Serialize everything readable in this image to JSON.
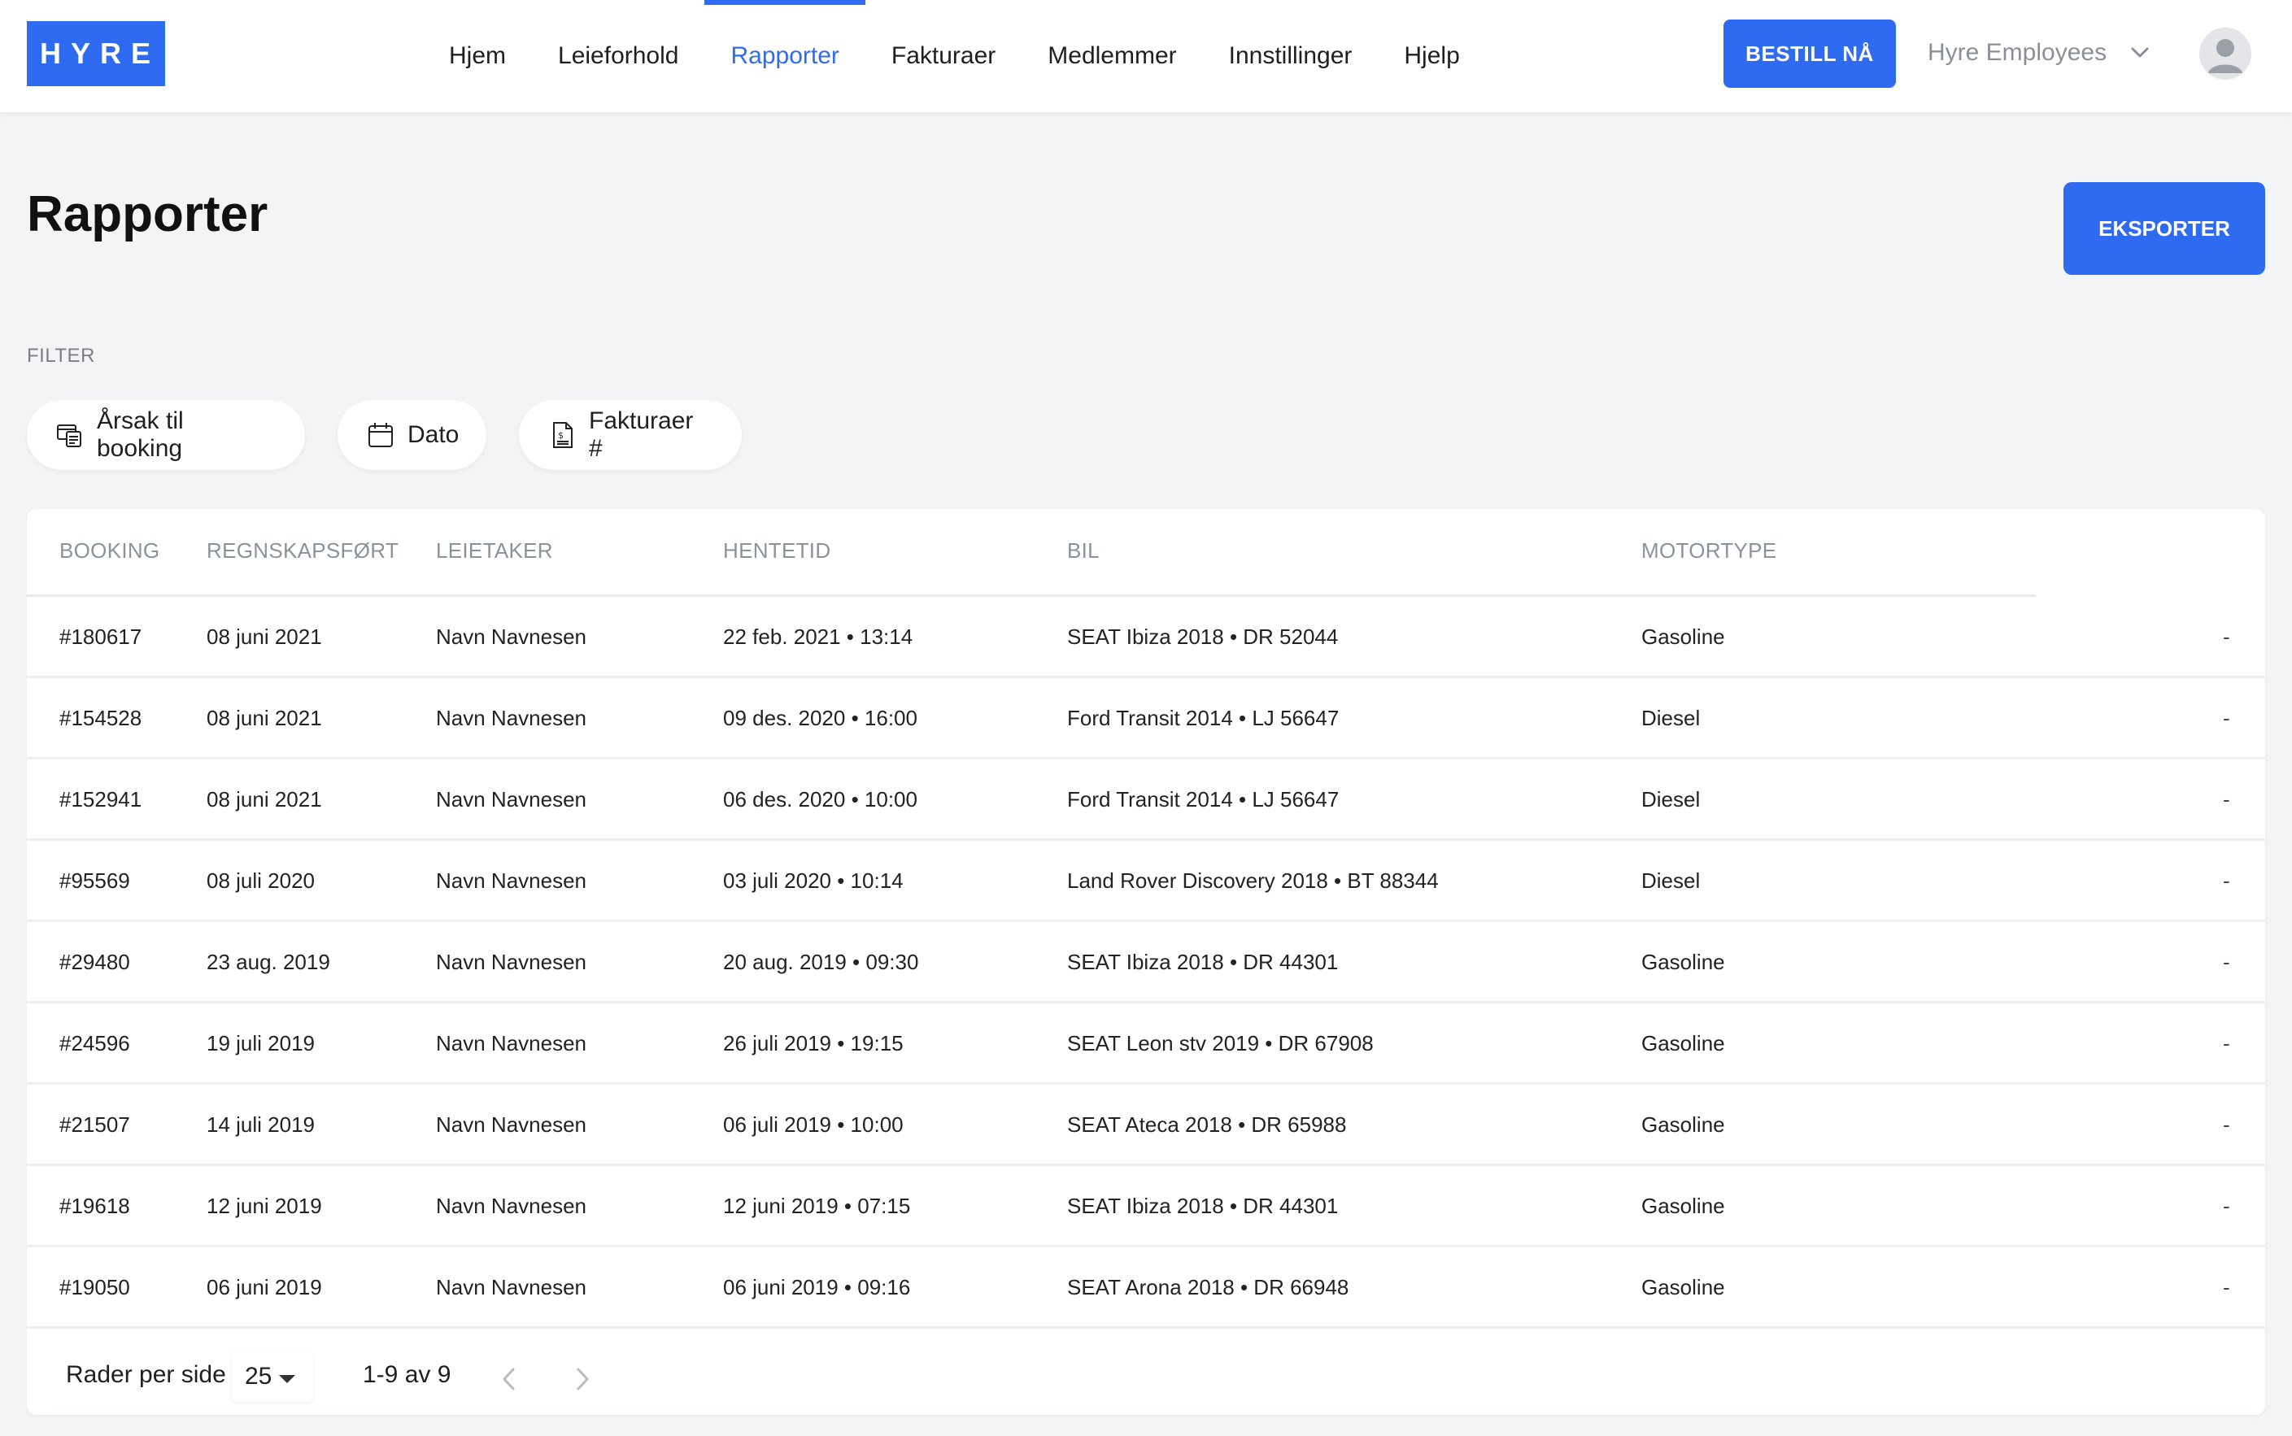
{
  "header": {
    "logo": "HYRE",
    "nav": [
      {
        "label": "Hjem",
        "active": false
      },
      {
        "label": "Leieforhold",
        "active": false
      },
      {
        "label": "Rapporter",
        "active": true
      },
      {
        "label": "Fakturaer",
        "active": false
      },
      {
        "label": "Medlemmer",
        "active": false
      },
      {
        "label": "Innstillinger",
        "active": false
      },
      {
        "label": "Hjelp",
        "active": false
      }
    ],
    "order_button": "BESTILL NÅ",
    "organization": "Hyre Employees",
    "organization_icon": "chevron-down-icon",
    "avatar_icon": "user-avatar-icon"
  },
  "page": {
    "title": "Rapporter",
    "export_button": "EKSPORTER"
  },
  "filters": {
    "label": "FILTER",
    "chips": [
      {
        "label": "Årsak til booking",
        "icon": "booking-reason-icon"
      },
      {
        "label": "Dato",
        "icon": "calendar-icon"
      },
      {
        "label": "Fakturaer #",
        "icon": "invoice-icon"
      }
    ]
  },
  "table": {
    "columns": [
      "BOOKING",
      "REGNSKAPSFØRT",
      "LEIETAKER",
      "HENTETID",
      "BIL",
      "MOTORTYPE"
    ],
    "rows": [
      {
        "booking": "#180617",
        "accounted": "08 juni 2021",
        "renter": "Navn Navnesen",
        "pickup": "22 feb. 2021 • 13:14",
        "car": "SEAT Ibiza 2018 • DR 52044",
        "engine": "Gasoline",
        "extra": "-"
      },
      {
        "booking": "#154528",
        "accounted": "08 juni 2021",
        "renter": "Navn Navnesen",
        "pickup": "09 des. 2020 • 16:00",
        "car": "Ford Transit 2014 • LJ 56647",
        "engine": "Diesel",
        "extra": "-"
      },
      {
        "booking": "#152941",
        "accounted": "08 juni 2021",
        "renter": "Navn Navnesen",
        "pickup": "06 des. 2020 • 10:00",
        "car": "Ford Transit 2014 • LJ 56647",
        "engine": "Diesel",
        "extra": "-"
      },
      {
        "booking": "#95569",
        "accounted": "08 juli 2020",
        "renter": "Navn Navnesen",
        "pickup": "03 juli 2020 • 10:14",
        "car": "Land Rover Discovery 2018 • BT 88344",
        "engine": "Diesel",
        "extra": "-"
      },
      {
        "booking": "#29480",
        "accounted": "23 aug. 2019",
        "renter": "Navn Navnesen",
        "pickup": "20 aug. 2019 • 09:30",
        "car": "SEAT Ibiza 2018 • DR 44301",
        "engine": "Gasoline",
        "extra": "-"
      },
      {
        "booking": "#24596",
        "accounted": "19 juli 2019",
        "renter": "Navn Navnesen",
        "pickup": "26 juli 2019 • 19:15",
        "car": "SEAT Leon stv 2019 • DR 67908",
        "engine": "Gasoline",
        "extra": "-"
      },
      {
        "booking": "#21507",
        "accounted": "14 juli 2019",
        "renter": "Navn Navnesen",
        "pickup": "06 juli 2019 • 10:00",
        "car": "SEAT Ateca 2018 • DR 65988",
        "engine": "Gasoline",
        "extra": "-"
      },
      {
        "booking": "#19618",
        "accounted": "12 juni 2019",
        "renter": "Navn Navnesen",
        "pickup": "12 juni 2019 • 07:15",
        "car": "SEAT Ibiza 2018 • DR 44301",
        "engine": "Gasoline",
        "extra": "-"
      },
      {
        "booking": "#19050",
        "accounted": "06 juni 2019",
        "renter": "Navn Navnesen",
        "pickup": "06 juni 2019 • 09:16",
        "car": "SEAT Arona 2018 • DR 66948",
        "engine": "Gasoline",
        "extra": "-"
      }
    ]
  },
  "pagination": {
    "rows_per_page_label": "Rader per side",
    "rows_per_page_value": "25",
    "range": "1-9 av 9",
    "prev_icon": "chevron-left-icon",
    "next_icon": "chevron-right-icon"
  },
  "colors": {
    "brand": "#2f6bf1",
    "background": "#f3f4f6",
    "muted_text": "#8a929c"
  }
}
